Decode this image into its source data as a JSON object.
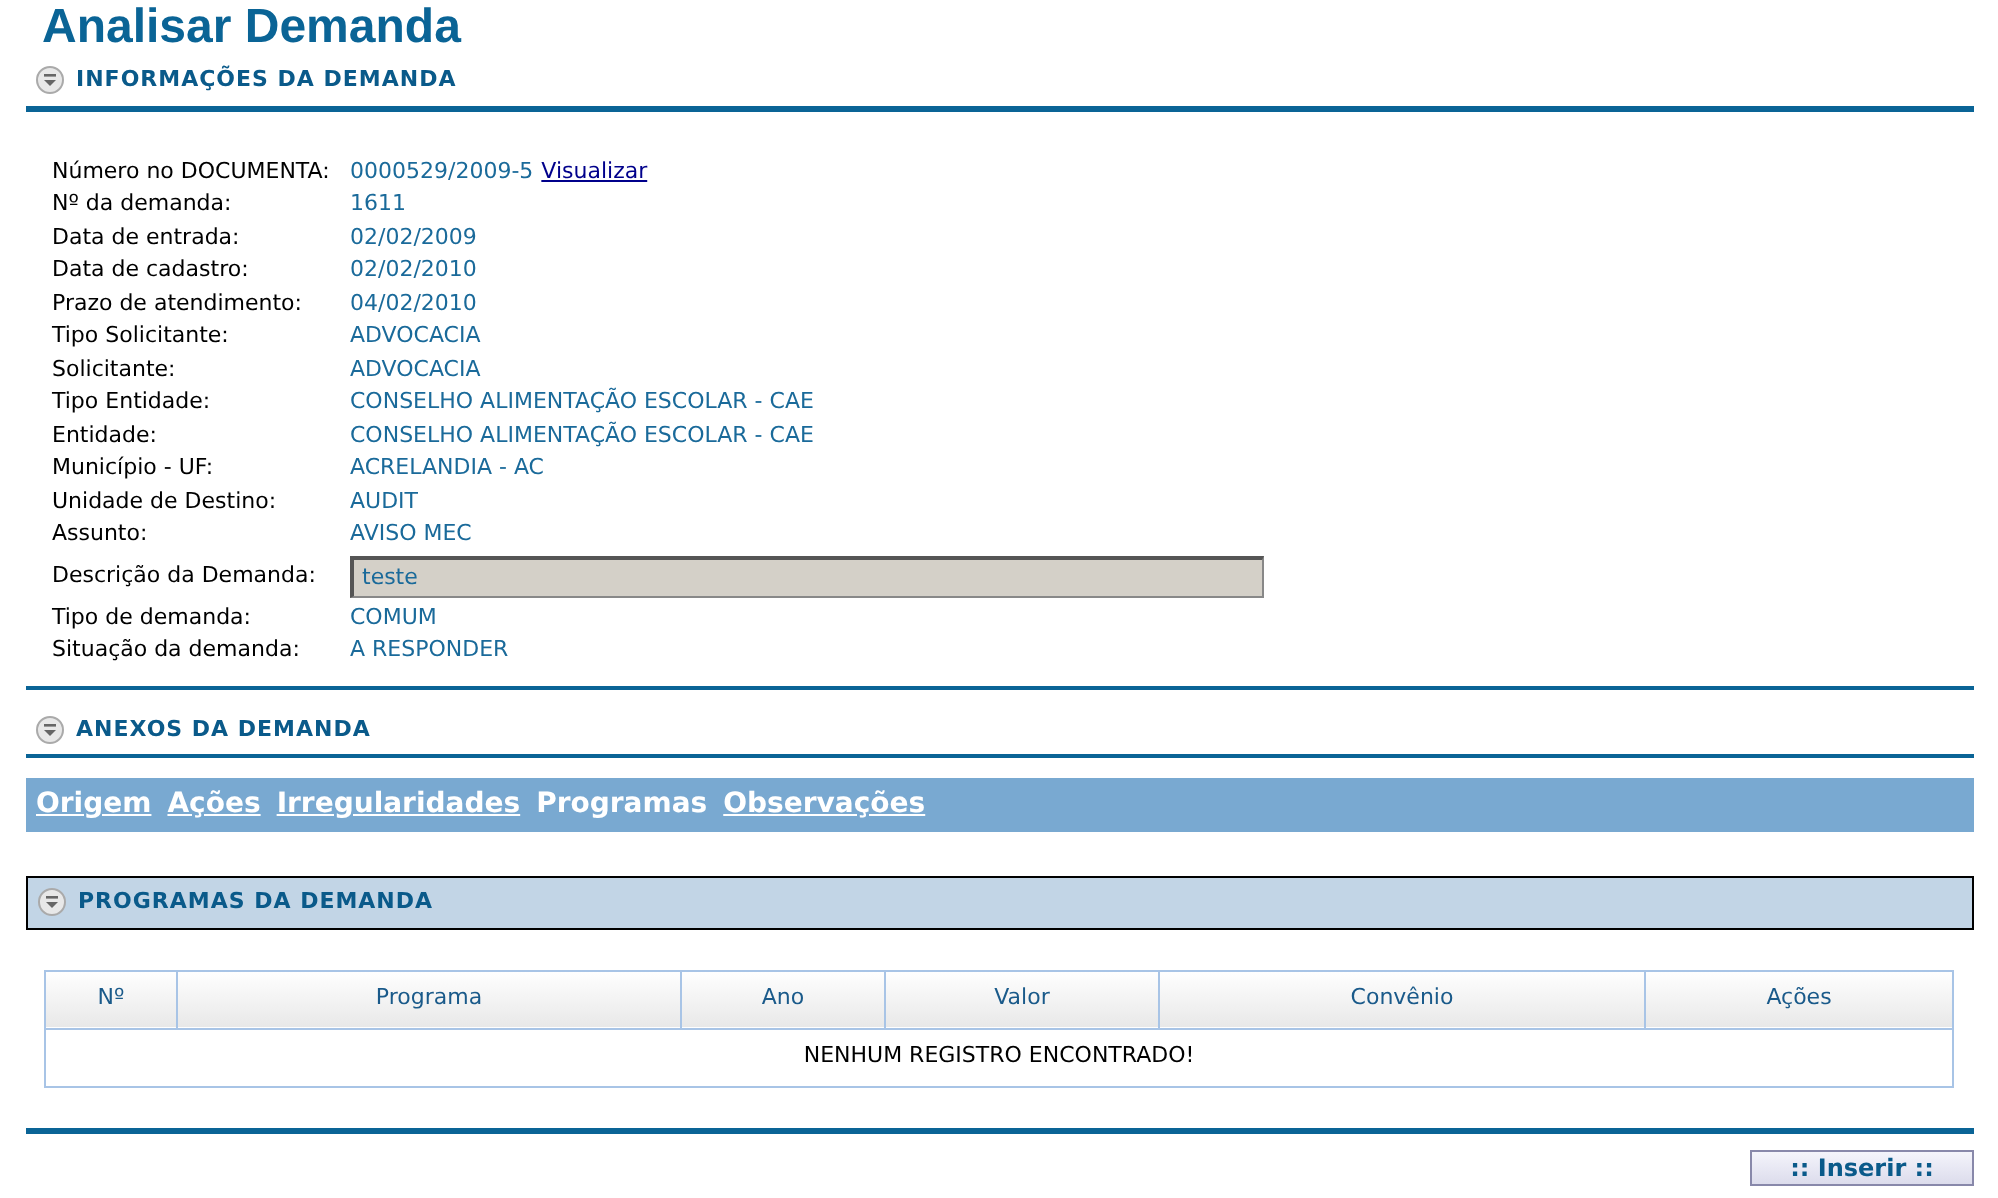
{
  "page_title": "Analisar Demanda",
  "info_section": {
    "title": "INFORMAÇÕES DA DEMANDA",
    "fields": [
      {
        "kind": "text",
        "label": "Número no DOCUMENTA:",
        "value": "0000529/2009-5",
        "link": "Visualizar"
      },
      {
        "kind": "text",
        "label": "Nº da demanda:",
        "value": "1611"
      },
      {
        "kind": "text",
        "label": "Data de entrada:",
        "value": "02/02/2009"
      },
      {
        "kind": "text",
        "label": "Data de cadastro:",
        "value": "02/02/2010"
      },
      {
        "kind": "text",
        "label": "Prazo de atendimento:",
        "value": "04/02/2010"
      },
      {
        "kind": "text",
        "label": "Tipo Solicitante:",
        "value": "ADVOCACIA"
      },
      {
        "kind": "text",
        "label": "Solicitante:",
        "value": "ADVOCACIA"
      },
      {
        "kind": "text",
        "label": "Tipo Entidade:",
        "value": "CONSELHO ALIMENTAÇÃO ESCOLAR - CAE"
      },
      {
        "kind": "text",
        "label": "Entidade:",
        "value": "CONSELHO ALIMENTAÇÃO ESCOLAR - CAE"
      },
      {
        "kind": "text",
        "label": "Município - UF:",
        "value": "ACRELANDIA - AC"
      },
      {
        "kind": "text",
        "label": "Unidade de Destino:",
        "value": "AUDIT"
      },
      {
        "kind": "text",
        "label": "Assunto:",
        "value": "AVISO MEC"
      },
      {
        "kind": "field",
        "label": "Descrição da Demanda:",
        "value": "teste"
      },
      {
        "kind": "text",
        "label": "Tipo de demanda:",
        "value": "COMUM"
      },
      {
        "kind": "text",
        "label": "Situação da demanda:",
        "value": "A RESPONDER"
      }
    ]
  },
  "attachments_section": {
    "title": "ANEXOS DA DEMANDA"
  },
  "tabs": [
    {
      "label": "Origem",
      "selected": false
    },
    {
      "label": "Ações",
      "selected": false
    },
    {
      "label": "Irregularidades",
      "selected": false
    },
    {
      "label": "Programas",
      "selected": true
    },
    {
      "label": "Observações",
      "selected": false
    }
  ],
  "programs_section": {
    "title": "PROGRAMAS DA DEMANDA",
    "table": {
      "columns": [
        "Nº",
        "Programa",
        "Ano",
        "Valor",
        "Convênio",
        "Ações"
      ],
      "empty_message": "NENHUM REGISTRO ENCONTRADO!"
    }
  },
  "buttons": [
    ":: Inserir ::"
  ]
}
